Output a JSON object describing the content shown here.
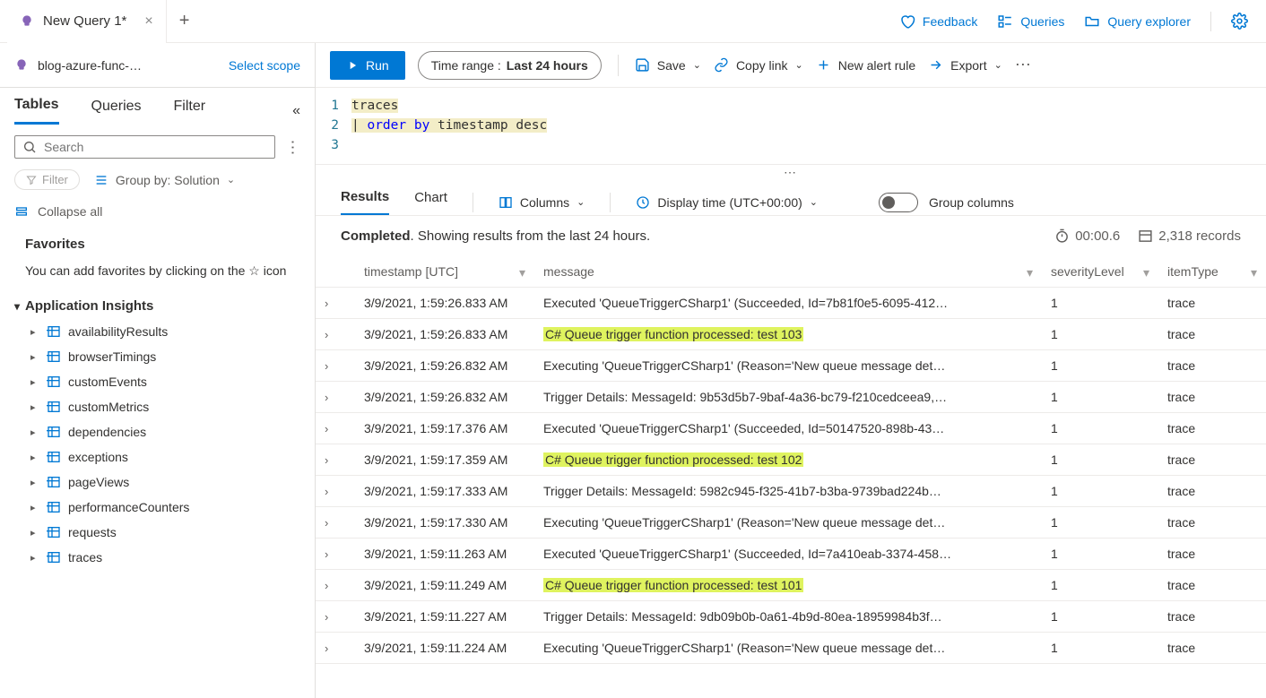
{
  "top": {
    "tab_title": "New Query 1*",
    "feedback": "Feedback",
    "queries": "Queries",
    "explorer": "Query explorer"
  },
  "sidebar": {
    "scope": "blog-azure-func-…",
    "select_scope": "Select scope",
    "tabs": {
      "tables": "Tables",
      "queries": "Queries",
      "filter": "Filter"
    },
    "search_placeholder": "Search",
    "filter_btn": "Filter",
    "groupby": "Group by: Solution",
    "collapse_all": "Collapse all",
    "favorites": "Favorites",
    "fav_hint": "You can add favorites by clicking on the ☆ icon",
    "section": "Application Insights",
    "tables_list": [
      "availabilityResults",
      "browserTimings",
      "customEvents",
      "customMetrics",
      "dependencies",
      "exceptions",
      "pageViews",
      "performanceCounters",
      "requests",
      "traces"
    ]
  },
  "toolbar": {
    "run": "Run",
    "time_label": "Time range :",
    "time_value": "Last 24 hours",
    "save": "Save",
    "copylink": "Copy link",
    "newalert": "New alert rule",
    "export": "Export"
  },
  "editor": {
    "line1": "traces",
    "line2_pipe": "| ",
    "line2_kw": "order by",
    "line2_rest": " timestamp desc"
  },
  "results": {
    "tab_results": "Results",
    "tab_chart": "Chart",
    "columns": "Columns",
    "display_time": "Display time (UTC+00:00)",
    "group_columns": "Group columns",
    "status_completed": "Completed",
    "status_rest": ". Showing results from the last 24 hours.",
    "duration": "00:00.6",
    "records": "2,318 records",
    "headers": {
      "ts": "timestamp [UTC]",
      "msg": "message",
      "sev": "severityLevel",
      "type": "itemType"
    },
    "rows": [
      {
        "ts": "3/9/2021, 1:59:26.833 AM",
        "msg": "Executed 'QueueTriggerCSharp1' (Succeeded, Id=7b81f0e5-6095-412…",
        "sev": "1",
        "type": "trace",
        "hl": false
      },
      {
        "ts": "3/9/2021, 1:59:26.833 AM",
        "msg": "C# Queue trigger function processed: test 103",
        "sev": "1",
        "type": "trace",
        "hl": true
      },
      {
        "ts": "3/9/2021, 1:59:26.832 AM",
        "msg": "Executing 'QueueTriggerCSharp1' (Reason='New queue message det…",
        "sev": "1",
        "type": "trace",
        "hl": false
      },
      {
        "ts": "3/9/2021, 1:59:26.832 AM",
        "msg": "Trigger Details: MessageId: 9b53d5b7-9baf-4a36-bc79-f210cedceea9,…",
        "sev": "1",
        "type": "trace",
        "hl": false
      },
      {
        "ts": "3/9/2021, 1:59:17.376 AM",
        "msg": "Executed 'QueueTriggerCSharp1' (Succeeded, Id=50147520-898b-43…",
        "sev": "1",
        "type": "trace",
        "hl": false
      },
      {
        "ts": "3/9/2021, 1:59:17.359 AM",
        "msg": "C# Queue trigger function processed: test 102",
        "sev": "1",
        "type": "trace",
        "hl": true
      },
      {
        "ts": "3/9/2021, 1:59:17.333 AM",
        "msg": "Trigger Details: MessageId: 5982c945-f325-41b7-b3ba-9739bad224b…",
        "sev": "1",
        "type": "trace",
        "hl": false
      },
      {
        "ts": "3/9/2021, 1:59:17.330 AM",
        "msg": "Executing 'QueueTriggerCSharp1' (Reason='New queue message det…",
        "sev": "1",
        "type": "trace",
        "hl": false
      },
      {
        "ts": "3/9/2021, 1:59:11.263 AM",
        "msg": "Executed 'QueueTriggerCSharp1' (Succeeded, Id=7a410eab-3374-458…",
        "sev": "1",
        "type": "trace",
        "hl": false
      },
      {
        "ts": "3/9/2021, 1:59:11.249 AM",
        "msg": "C# Queue trigger function processed: test 101",
        "sev": "1",
        "type": "trace",
        "hl": true
      },
      {
        "ts": "3/9/2021, 1:59:11.227 AM",
        "msg": "Trigger Details: MessageId: 9db09b0b-0a61-4b9d-80ea-18959984b3f…",
        "sev": "1",
        "type": "trace",
        "hl": false
      },
      {
        "ts": "3/9/2021, 1:59:11.224 AM",
        "msg": "Executing 'QueueTriggerCSharp1' (Reason='New queue message det…",
        "sev": "1",
        "type": "trace",
        "hl": false
      }
    ]
  }
}
